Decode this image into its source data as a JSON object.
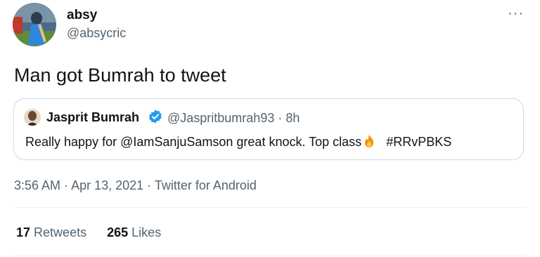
{
  "tweet": {
    "author": {
      "display_name": "absy",
      "handle": "@absycric",
      "avatar_icon": "cricketer-avatar"
    },
    "more_icon": "more-options-icon",
    "more_label": "···",
    "text": "Man got Bumrah to tweet",
    "quoted": {
      "display_name": "Jasprit Bumrah",
      "verified_icon": "verified-badge-icon",
      "handle_time": "@Jaspritbumrah93 · 8h",
      "text_before": "Really happy for @IamSanjuSamson great knock. Top class",
      "emoji": "fire-emoji",
      "hashtag": "#RRvPBKS"
    },
    "meta": {
      "time": "3:56 AM",
      "sep1": " · ",
      "date": "Apr 13, 2021",
      "sep2": " · ",
      "source": "Twitter for Android"
    },
    "stats": {
      "retweets_count": "17",
      "retweets_label": "Retweets",
      "likes_count": "265",
      "likes_label": "Likes"
    },
    "colors": {
      "verified": "#1d9bf0",
      "secondary_text": "#536471",
      "border": "#cfd9de"
    }
  }
}
